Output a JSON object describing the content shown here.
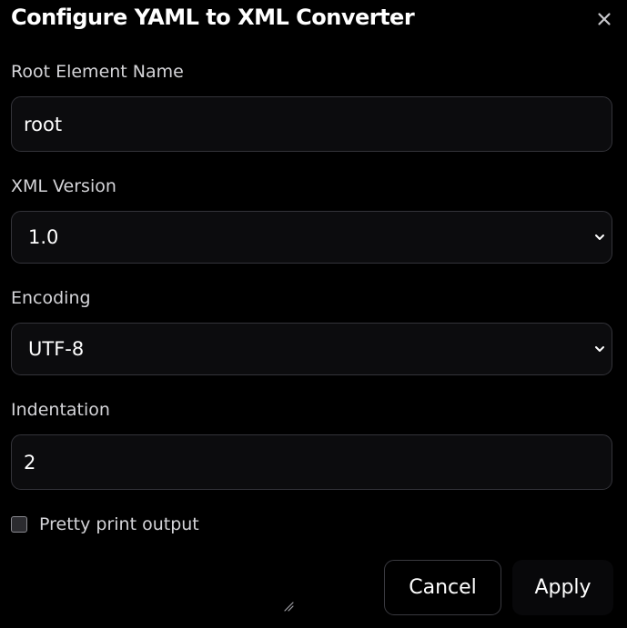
{
  "dialog": {
    "title": "Configure YAML to XML Converter",
    "close_icon": "close-icon"
  },
  "fields": {
    "root_element": {
      "label": "Root Element Name",
      "value": "root"
    },
    "xml_version": {
      "label": "XML Version",
      "selected": "1.0"
    },
    "encoding": {
      "label": "Encoding",
      "selected": "UTF-8"
    },
    "indentation": {
      "label": "Indentation",
      "value": "2"
    }
  },
  "pretty_print": {
    "label": "Pretty print output",
    "checked": false
  },
  "buttons": {
    "cancel_label": "Cancel",
    "apply_label": "Apply"
  },
  "icons": {
    "close": "close-icon",
    "select_chevron": "chevron-down-icon",
    "resize": "resize-handle-icon"
  },
  "colors": {
    "background": "#000000",
    "field_background": "#0c0c0e",
    "field_border": "#34343a",
    "label_text": "#d4d4d8",
    "value_text": "#ffffff"
  }
}
